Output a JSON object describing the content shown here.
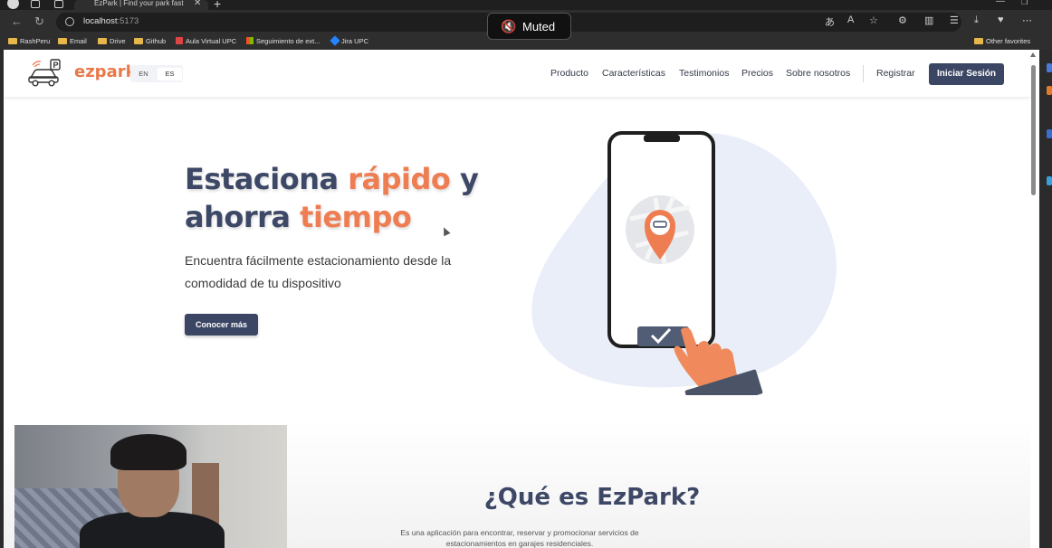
{
  "browser": {
    "tab_title": "EzPark | Find your park fast",
    "tab_close": "✕",
    "new_tab": "+",
    "url_host": "localhost",
    "url_port": ":5173",
    "bookmarks": [
      {
        "label": "RashPeru"
      },
      {
        "label": "Email"
      },
      {
        "label": "Drive"
      },
      {
        "label": "Github"
      },
      {
        "label": "Aula Virtual UPC"
      },
      {
        "label": "Seguimiento de ext..."
      },
      {
        "label": "Jira UPC"
      }
    ],
    "other_favorites": "Other favorites",
    "accent_color": "#3b4664"
  },
  "overlay": {
    "muted_label": "Muted"
  },
  "navbar": {
    "brand": "ezpark",
    "lang_en": "EN",
    "lang_es": "ES",
    "links": [
      "Producto",
      "Características",
      "Testimonios",
      "Precios",
      "Sobre nosotros"
    ],
    "register": "Registrar",
    "login": "Iniciar Sesión"
  },
  "hero": {
    "title_part1": "Estaciona ",
    "title_accent1": "rápido",
    "title_part2": " y",
    "title_part3": "ahorra ",
    "title_accent2": "tiempo",
    "subtitle": "Encuentra fácilmente estacionamiento desde la comodidad de tu dispositivo",
    "cta": "Conocer más",
    "accent_color": "#ee7d52",
    "primary_color": "#3d4866"
  },
  "about": {
    "title": "¿Qué es EzPark?",
    "description": "Es una aplicación para encontrar, reservar y promocionar servicios de estacionamientos en garajes residenciales."
  }
}
